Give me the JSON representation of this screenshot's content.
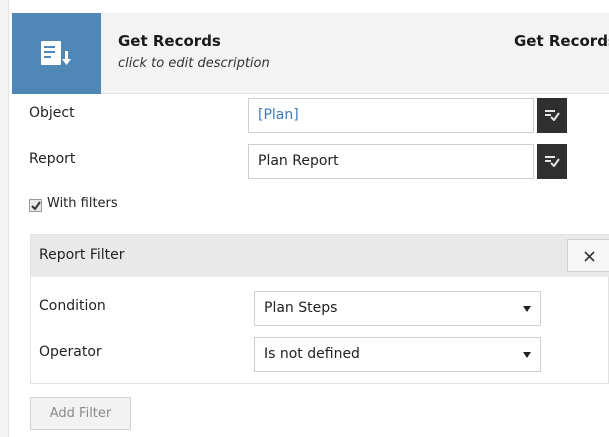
{
  "header": {
    "title": "Get Records",
    "description": "click to edit description",
    "element_type": "Get Records",
    "tile_color": "#4f87b6",
    "icon": "get-records-icon"
  },
  "fields": {
    "object_label": "Object",
    "object_value": "[Plan]",
    "report_label": "Report",
    "report_value": "Plan Report",
    "picker_icon": "select-list-icon"
  },
  "with_filters": {
    "label": "With filters",
    "checked": true
  },
  "filter": {
    "title": "Report Filter",
    "close_icon": "close-icon",
    "condition_label": "Condition",
    "condition_value": "Plan Steps",
    "operator_label": "Operator",
    "operator_value": "Is not defined"
  },
  "add_filter_label": "Add Filter"
}
